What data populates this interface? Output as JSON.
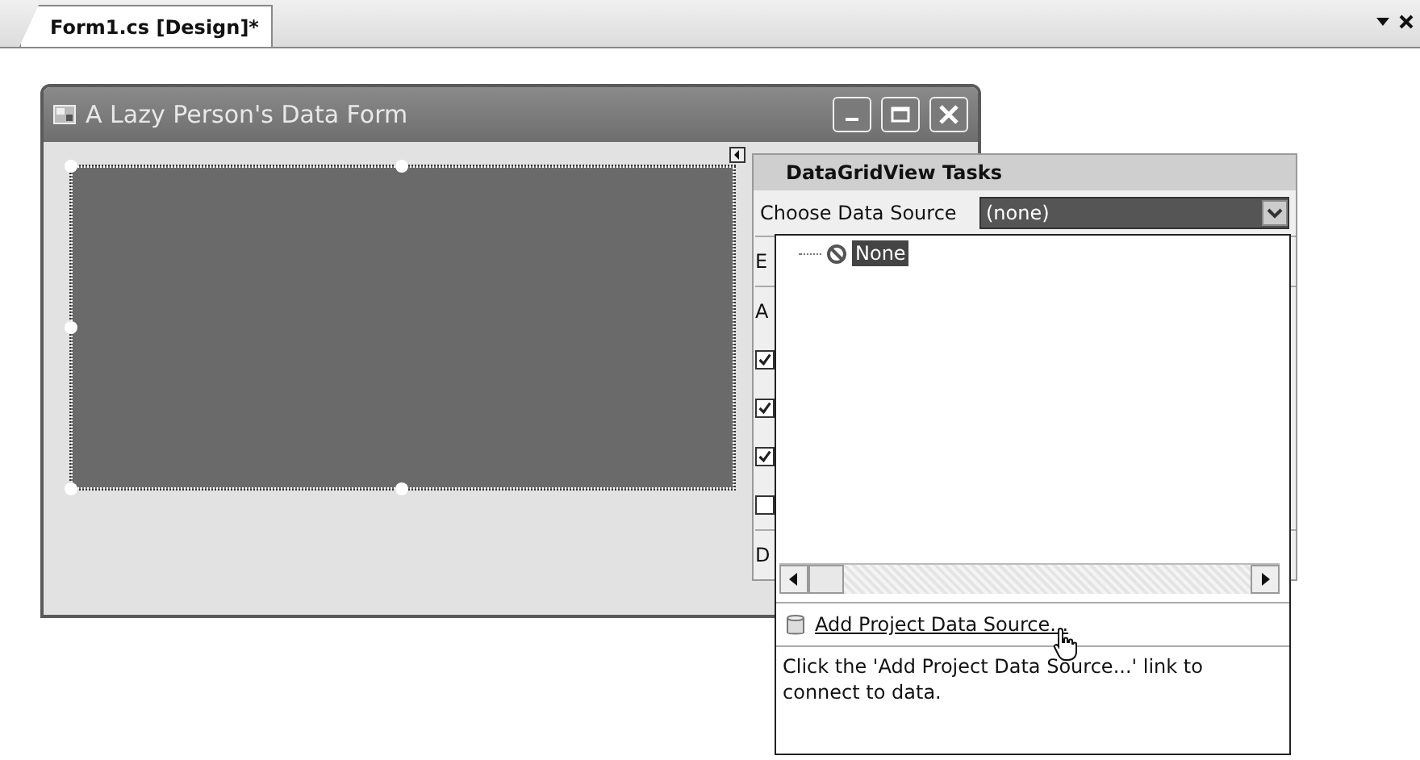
{
  "document_tab": {
    "label": "Form1.cs [Design]*",
    "selected": true
  },
  "form": {
    "title": "A Lazy Person's Data Form"
  },
  "smart_tag": {
    "title": "DataGridView Tasks",
    "data_source_label": "Choose Data Source",
    "data_source_value": "(none)",
    "covered_rows": [
      {
        "kind": "text",
        "label": "E"
      },
      {
        "kind": "text",
        "label": "A"
      },
      {
        "kind": "checkbox",
        "checked": true
      },
      {
        "kind": "checkbox",
        "checked": true
      },
      {
        "kind": "checkbox",
        "checked": true
      },
      {
        "kind": "checkbox",
        "checked": false
      },
      {
        "kind": "text",
        "label": "D"
      }
    ]
  },
  "dropdown": {
    "tree": [
      {
        "label": "None",
        "selected": true
      }
    ],
    "link": "Add Project Data Source...",
    "hint": "Click the 'Add Project Data Source...' link to connect to data."
  }
}
